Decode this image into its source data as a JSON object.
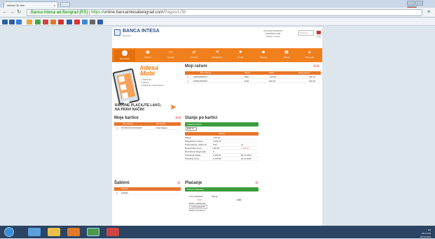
{
  "browser": {
    "tab_title": "Intesa On-line",
    "tab_close": "×",
    "secure_label": "Banca Intesa ad Beograd [RS]",
    "url_scheme": "https://",
    "url_host": "online.bancaintesabeograd.com",
    "url_path": "/Pages/L/38"
  },
  "header": {
    "logo_text": "BANCA INTESA",
    "logo_sub": "Beograd",
    "info_lines": [
      "DOLAZNI RANKING",
      "PREZIME I IME",
      "Datum i vreme"
    ],
    "search_placeholder": "Pretraga"
  },
  "menu": [
    {
      "icon": "home-icon",
      "glyph": "⌂",
      "label": "Moj Intesa"
    },
    {
      "icon": "wallet-icon",
      "glyph": "▣",
      "label": "Računi"
    },
    {
      "icon": "card-icon",
      "glyph": "▭",
      "label": "Kartice"
    },
    {
      "icon": "transfer-icon",
      "glyph": "⇄",
      "label": "Prenosi"
    },
    {
      "icon": "exchange-icon",
      "glyph": "⟲",
      "label": "Menjačnica"
    },
    {
      "icon": "credit-icon",
      "glyph": "■",
      "label": "Krediti"
    },
    {
      "icon": "savings-icon",
      "glyph": "◆",
      "label": "Štednja"
    },
    {
      "icon": "insurance-icon",
      "glyph": "▦",
      "label": "Usluge"
    },
    {
      "icon": "profile-icon",
      "glyph": "▲",
      "label": "Moj profil"
    }
  ],
  "ad": {
    "title_line1": "Intesa",
    "title_line2": "Mobi",
    "bullets": [
      "NOVOST",
      "Računi",
      "Plaćanje u trgovinama"
    ],
    "footer_line1": "RAČUNE PLAĆAJTE LAKO,",
    "footer_line2": "NA PRAVI NAČIN!"
  },
  "moji_racuni": {
    "title": "Moji računi",
    "headers": [
      "Broj računa",
      "Valuta",
      "Saldo",
      "Raspoloživo"
    ],
    "rows": [
      [
        "160010000075",
        "RSD",
        "-195,16",
        "495,16"
      ],
      [
        "160001810015",
        "EUR",
        "220,00",
        "220,00"
      ]
    ]
  },
  "moje_kartice": {
    "title": "Moje kartice",
    "headers": [
      "Broj kartice",
      "Tip kartice"
    ],
    "rows": [
      [
        "5179XXXXXXXX1100",
        "Dina Master"
      ]
    ]
  },
  "stanje": {
    "title": "Stanje po kartici",
    "green_label": "Izaberite karticu",
    "currency": "RSD",
    "header": "Stanje",
    "rows": [
      [
        "Stanje",
        "-195,16",
        ""
      ],
      [
        "Raspoloživo stanje",
        "1.000,16",
        ""
      ],
      [
        "Prekoračenje odobreno",
        "0,00",
        "ne"
      ],
      [
        "Rezervisani iznos",
        "195,00",
        "+ Prikaži"
      ],
      [
        "Neizmirena dugovanja",
        "0",
        ""
      ],
      [
        "Poslednja uplata",
        "1.000,00",
        "05.12.2012"
      ],
      [
        "Poslednji izvod",
        "2.105,00",
        "01.12.2012"
      ]
    ]
  },
  "sablon": {
    "title": "Šabloni",
    "header": "Šabloni",
    "rows": [
      "Izabrati"
    ]
  },
  "placanje": {
    "title": "Plaćanje",
    "green_label": "Prenos sredstava",
    "fields": [
      {
        "label": "Iznos plaćanja *",
        "value": "Valuta"
      },
      {
        "label": "RSD",
        "value": "0,00"
      },
      {
        "label": "Račun zaduženja",
        "value": "160010000075"
      },
      {
        "label": "Račun primaoca *",
        "value": ""
      }
    ]
  },
  "taskbar": {
    "time": "05:17 PM",
    "date": "06.12.2012",
    "lang": "EN"
  }
}
